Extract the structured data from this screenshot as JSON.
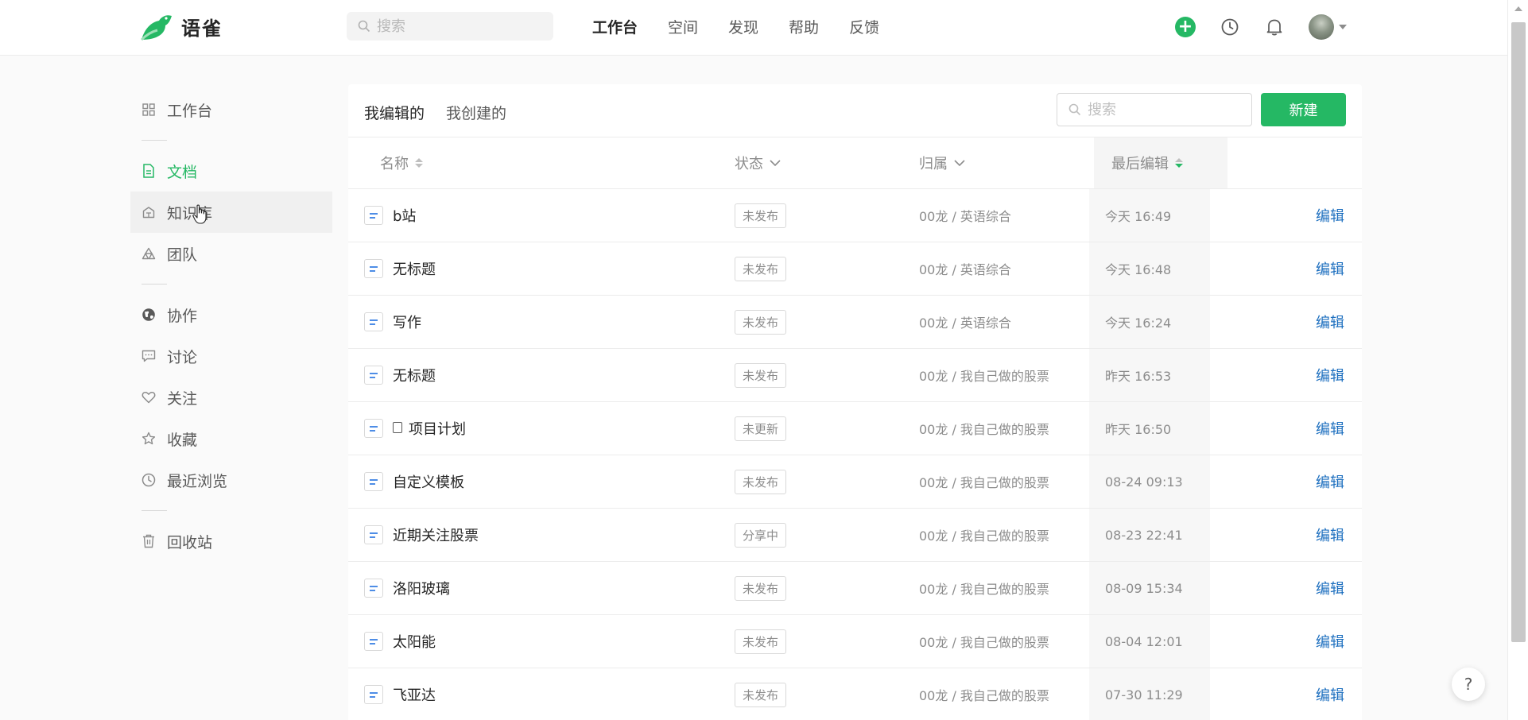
{
  "app": {
    "name": "语雀"
  },
  "topbar": {
    "search_placeholder": "搜索",
    "nav": [
      {
        "label": "工作台",
        "active": true
      },
      {
        "label": "空间",
        "active": false
      },
      {
        "label": "发现",
        "active": false
      },
      {
        "label": "帮助",
        "active": false
      },
      {
        "label": "反馈",
        "active": false
      }
    ],
    "icons": [
      "plus-icon",
      "clock-icon",
      "bell-icon",
      "avatar",
      "caret-down-icon"
    ]
  },
  "sidebar": {
    "items": [
      {
        "label": "工作台",
        "icon": "grid-icon"
      },
      {
        "label": "文档",
        "icon": "document-icon",
        "active": true
      },
      {
        "label": "知识库",
        "icon": "library-icon",
        "hover": true
      },
      {
        "label": "团队",
        "icon": "team-icon"
      },
      {
        "label": "协作",
        "icon": "globe-icon"
      },
      {
        "label": "讨论",
        "icon": "comment-icon"
      },
      {
        "label": "关注",
        "icon": "heart-icon"
      },
      {
        "label": "收藏",
        "icon": "star-icon"
      },
      {
        "label": "最近浏览",
        "icon": "clock-icon"
      },
      {
        "label": "回收站",
        "icon": "trash-icon"
      }
    ]
  },
  "main": {
    "tabs": [
      {
        "label": "我编辑的",
        "active": true
      },
      {
        "label": "我创建的",
        "active": false
      }
    ],
    "search_placeholder": "搜索",
    "new_button": "新建",
    "columns": {
      "name": "名称",
      "status": "状态",
      "belongs": "归属",
      "last_edit": "最后编辑"
    },
    "rows": [
      {
        "name": "b站",
        "status": "未发布",
        "belongs": "00龙 / 英语综合",
        "time": "今天 16:49",
        "action": "编辑"
      },
      {
        "name": "无标题",
        "status": "未发布",
        "belongs": "00龙 / 英语综合",
        "time": "今天 16:48",
        "action": "编辑"
      },
      {
        "name": "写作",
        "status": "未发布",
        "belongs": "00龙 / 英语综合",
        "time": "今天 16:24",
        "action": "编辑"
      },
      {
        "name": "无标题",
        "status": "未发布",
        "belongs": "00龙 / 我自己做的股票",
        "time": "昨天 16:53",
        "action": "编辑"
      },
      {
        "name": "项目计划",
        "status": "未更新",
        "belongs": "00龙 / 我自己做的股票",
        "time": "昨天 16:50",
        "action": "编辑",
        "has_emoji": true
      },
      {
        "name": "自定义模板",
        "status": "未发布",
        "belongs": "00龙 / 我自己做的股票",
        "time": "08-24 09:13",
        "action": "编辑"
      },
      {
        "name": "近期关注股票",
        "status": "分享中",
        "belongs": "00龙 / 我自己做的股票",
        "time": "08-23 22:41",
        "action": "编辑"
      },
      {
        "name": "洛阳玻璃",
        "status": "未发布",
        "belongs": "00龙 / 我自己做的股票",
        "time": "08-09 15:34",
        "action": "编辑"
      },
      {
        "name": "太阳能",
        "status": "未发布",
        "belongs": "00龙 / 我自己做的股票",
        "time": "08-04 12:01",
        "action": "编辑"
      },
      {
        "name": "飞亚达",
        "status": "未发布",
        "belongs": "00龙 / 我自己做的股票",
        "time": "07-30 11:29",
        "action": "编辑"
      }
    ]
  },
  "help": {
    "label": "?"
  },
  "colors": {
    "brand": "#25b864",
    "link": "#1d6fbf"
  }
}
